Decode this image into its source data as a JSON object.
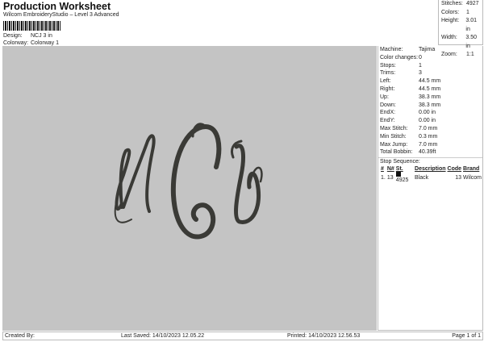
{
  "header": {
    "title": "Production Worksheet",
    "subtitle": "Wilcom EmbroideryStudio – Level 3 Advanced",
    "design_label": "Design:",
    "design_value": "NCJ 3 in",
    "colorway_label": "Colorway:",
    "colorway_value": "Colorway 1"
  },
  "summary": [
    {
      "k": "Stitches:",
      "v": "4927"
    },
    {
      "k": "Colors:",
      "v": "1"
    },
    {
      "k": "Height:",
      "v": "3.01 in"
    },
    {
      "k": "Width:",
      "v": "3.50 in"
    },
    {
      "k": "Zoom:",
      "v": "1:1"
    }
  ],
  "details": [
    {
      "k": "Machine:",
      "v": "Tajima"
    },
    {
      "k": "Color changes:",
      "v": "0"
    },
    {
      "k": "Stops:",
      "v": "1"
    },
    {
      "k": "Trims:",
      "v": "3"
    },
    {
      "k": "Left:",
      "v": "44.5 mm"
    },
    {
      "k": "Right:",
      "v": "44.5 mm"
    },
    {
      "k": "Up:",
      "v": "38.3 mm"
    },
    {
      "k": "Down:",
      "v": "38.3 mm"
    },
    {
      "k": "EndX:",
      "v": "0.00 in"
    },
    {
      "k": "EndY:",
      "v": "0.00 in"
    },
    {
      "k": "Max Stitch:",
      "v": "7.0 mm"
    },
    {
      "k": "Min Stitch:",
      "v": "0.3 mm"
    },
    {
      "k": "Max Jump:",
      "v": "7.0 mm"
    },
    {
      "k": "Total Bobbin:",
      "v": "40.39ft"
    }
  ],
  "stop_sequence": {
    "label": "Stop Sequence:",
    "columns": [
      "#",
      "N#",
      "St.",
      "Description",
      "Code",
      "Brand"
    ],
    "rows": [
      {
        "num": "1.",
        "n": "13",
        "color": "#111111",
        "st": "4925",
        "desc": "Black",
        "code": "13",
        "brand": "Wilcom"
      }
    ]
  },
  "design": {
    "thread_color": "#3a3a36",
    "background": "#c4c4c4"
  },
  "footer": {
    "created": "Created By:",
    "saved": "Last Saved: 14/10/2023 12.05.22",
    "printed": "Printed: 14/10/2023 12.56.53",
    "page": "Page 1 of 1"
  }
}
